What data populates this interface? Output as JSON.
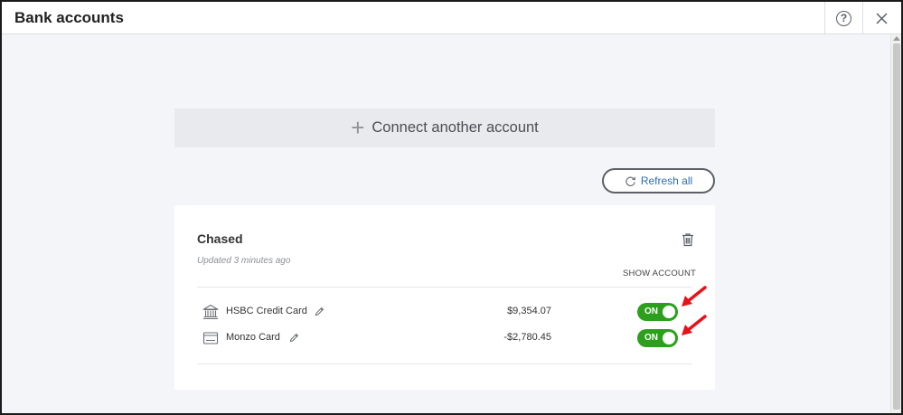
{
  "window": {
    "title": "Bank accounts",
    "help_symbol": "?",
    "close_symbol": "✕"
  },
  "connect": {
    "plus": "+",
    "label": "Connect another account"
  },
  "refresh": {
    "label": "Refresh all"
  },
  "bank": {
    "name": "Chased",
    "updated": "Updated 3 minutes ago",
    "show_account_header": "SHOW ACCOUNT",
    "accounts": [
      {
        "name": "HSBC Credit Card",
        "icon": "bank-icon",
        "amount": "$9,354.07",
        "show": true,
        "toggle_label": "ON"
      },
      {
        "name": "Monzo Card",
        "icon": "card-icon",
        "amount": "-$2,780.45",
        "show": true,
        "toggle_label": "ON"
      }
    ]
  },
  "colors": {
    "toggle_on": "#2ca01c",
    "link": "#2e6fb0",
    "annotation_arrow": "#e8121a"
  }
}
